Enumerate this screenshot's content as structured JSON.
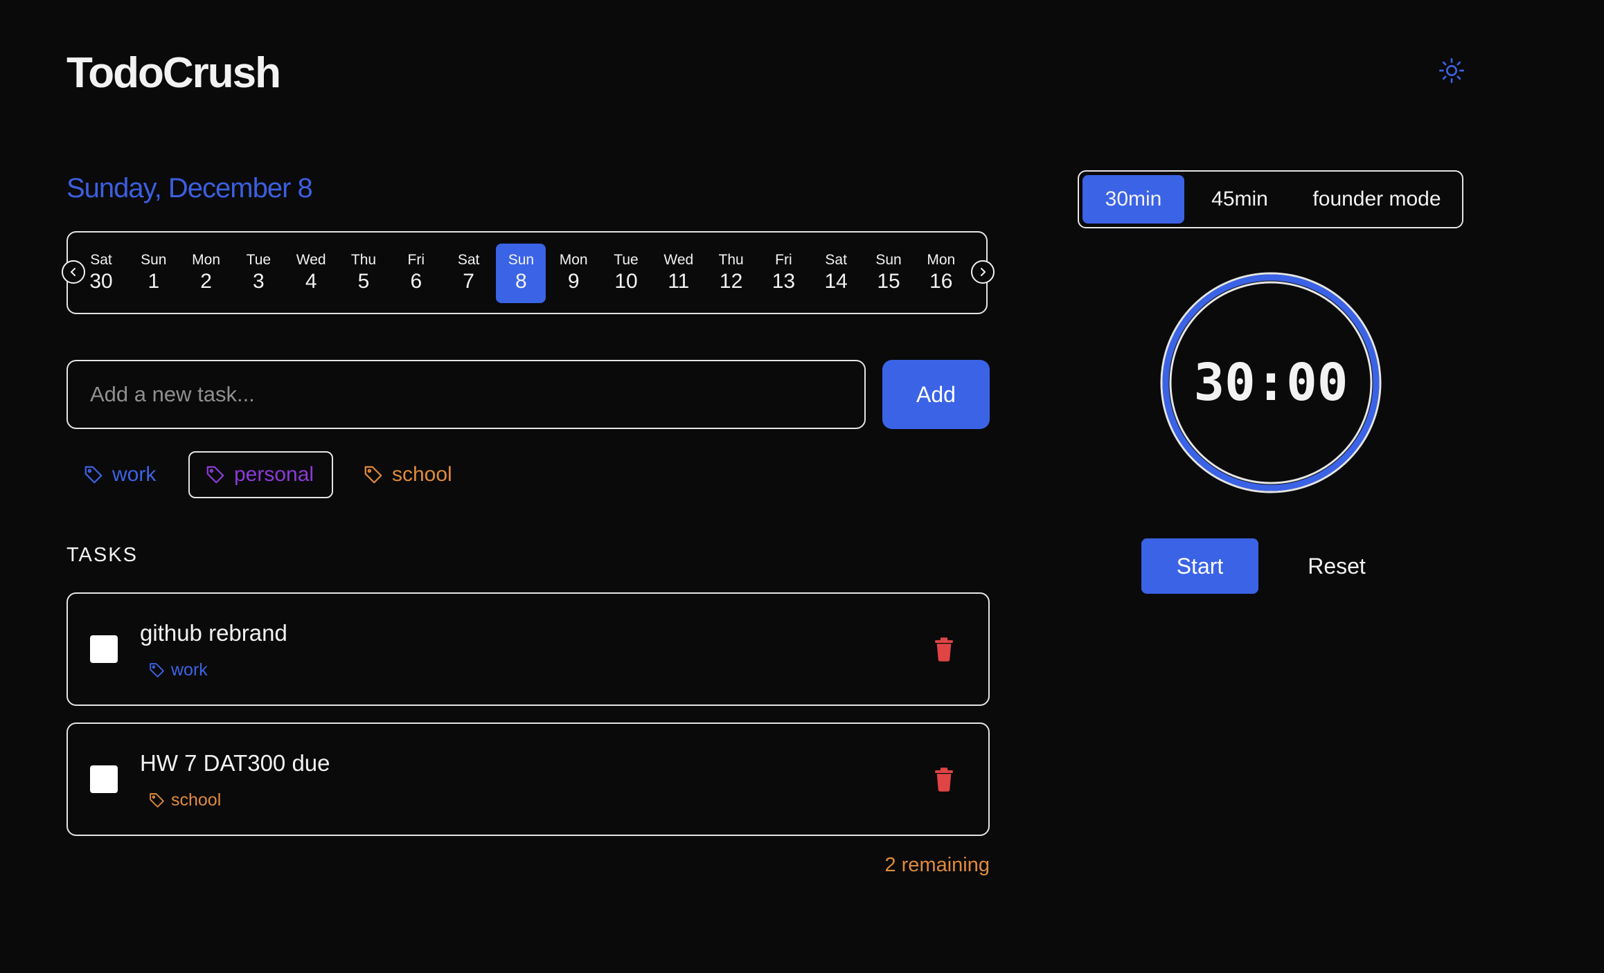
{
  "app": {
    "title": "TodoCrush"
  },
  "icons": {
    "theme_toggle": "sun-icon",
    "tag": "tag-icon",
    "delete": "trash-icon",
    "prev": "chevron-left-icon",
    "next": "chevron-right-icon"
  },
  "colors": {
    "accent": "#3b63e6",
    "work": "#3b63e6",
    "personal": "#8a3bd6",
    "school": "#e08a3c",
    "delete": "#e04444"
  },
  "calendar": {
    "heading": "Sunday, December 8",
    "days": [
      {
        "name": "Sat",
        "num": "30"
      },
      {
        "name": "Sun",
        "num": "1"
      },
      {
        "name": "Mon",
        "num": "2"
      },
      {
        "name": "Tue",
        "num": "3"
      },
      {
        "name": "Wed",
        "num": "4"
      },
      {
        "name": "Thu",
        "num": "5"
      },
      {
        "name": "Fri",
        "num": "6"
      },
      {
        "name": "Sat",
        "num": "7"
      },
      {
        "name": "Sun",
        "num": "8",
        "selected": true
      },
      {
        "name": "Mon",
        "num": "9"
      },
      {
        "name": "Tue",
        "num": "10"
      },
      {
        "name": "Wed",
        "num": "11"
      },
      {
        "name": "Thu",
        "num": "12"
      },
      {
        "name": "Fri",
        "num": "13"
      },
      {
        "name": "Sat",
        "num": "14"
      },
      {
        "name": "Sun",
        "num": "15"
      },
      {
        "name": "Mon",
        "num": "16"
      }
    ]
  },
  "new_task": {
    "placeholder": "Add a new task...",
    "value": "",
    "add_label": "Add"
  },
  "tags": [
    {
      "label": "work",
      "color": "#3b63e6",
      "active": false
    },
    {
      "label": "personal",
      "color": "#8a3bd6",
      "active": true
    },
    {
      "label": "school",
      "color": "#e08a3c",
      "active": false
    }
  ],
  "tasks": {
    "heading": "TASKS",
    "items": [
      {
        "title": "github rebrand",
        "tag": "work",
        "tag_color": "#3b63e6",
        "done": false
      },
      {
        "title": "HW 7 DAT300 due",
        "tag": "school",
        "tag_color": "#e08a3c",
        "done": false
      }
    ],
    "remaining": "2 remaining"
  },
  "timer": {
    "modes": [
      {
        "label": "30min",
        "active": true
      },
      {
        "label": "45min",
        "active": false
      },
      {
        "label": "founder mode",
        "active": false
      }
    ],
    "display": "30:00",
    "start_label": "Start",
    "reset_label": "Reset"
  }
}
